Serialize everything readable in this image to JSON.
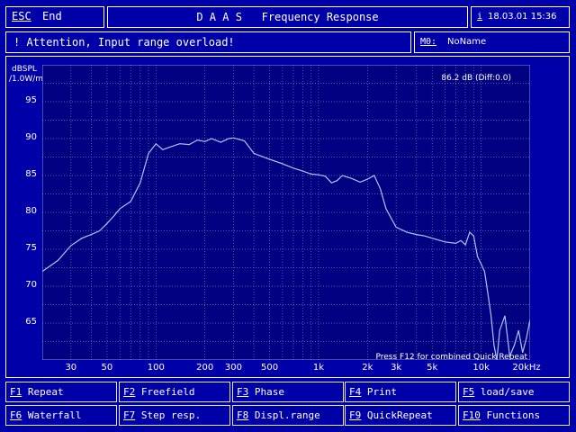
{
  "header": {
    "esc_key": "ESC",
    "esc_label": "End",
    "title": "D A A S   Frequency Response",
    "info_key": "i",
    "datetime": "18.03.01 15:36"
  },
  "status": {
    "message": "! Attention, Input range overload!",
    "memory_label": "M0:",
    "memory_value": "NoName"
  },
  "plot": {
    "ylabel_line1": "dBSPL",
    "ylabel_line2": "/1.0W/m",
    "readout": "86.2 dB (Diff:0.0)",
    "hint": "Press F12 for combined Quick Repeat"
  },
  "chart_data": {
    "type": "line",
    "xscale": "log",
    "xlim": [
      20,
      20000
    ],
    "ylim": [
      60,
      100
    ],
    "xlabel": "",
    "ylabel": "dBSPL /1.0W/m",
    "grid": true,
    "yticks": [
      65,
      70,
      75,
      80,
      85,
      90,
      95
    ],
    "xtick_labels": [
      "30",
      "50",
      "100",
      "200",
      "300",
      "500",
      "1k",
      "2k",
      "3k",
      "5k",
      "10k",
      "20kHz"
    ],
    "xticks": [
      30,
      50,
      100,
      200,
      300,
      500,
      1000,
      2000,
      3000,
      5000,
      10000,
      20000
    ],
    "series": [
      {
        "color": "#a8c8ff",
        "x": [
          20,
          25,
          30,
          35,
          40,
          45,
          50,
          55,
          60,
          70,
          80,
          90,
          100,
          110,
          120,
          140,
          160,
          180,
          200,
          220,
          250,
          280,
          300,
          350,
          400,
          500,
          600,
          700,
          800,
          900,
          1000,
          1100,
          1200,
          1300,
          1400,
          1600,
          1800,
          2000,
          2200,
          2400,
          2600,
          3000,
          3500,
          4000,
          4500,
          5000,
          6000,
          7000,
          7500,
          8000,
          8500,
          9000,
          9500,
          10000,
          10500,
          11000,
          11500,
          12000,
          12500,
          13000,
          14000,
          15000,
          16000,
          17000,
          18000,
          19000,
          20000
        ],
        "y": [
          72,
          73.5,
          75.5,
          76.5,
          77,
          77.5,
          78.5,
          79.5,
          80.5,
          81.5,
          84,
          88,
          89.3,
          88.5,
          88.8,
          89.3,
          89.2,
          89.8,
          89.6,
          90,
          89.5,
          90,
          90.1,
          89.7,
          88,
          87.2,
          86.6,
          86,
          85.6,
          85.2,
          85.1,
          84.9,
          84,
          84.3,
          85,
          84.6,
          84.1,
          84.5,
          85,
          83.2,
          80.5,
          78,
          77.3,
          77,
          76.8,
          76.5,
          76,
          75.8,
          76.2,
          75.6,
          77.3,
          76.8,
          74,
          73,
          72,
          69,
          66,
          62,
          60,
          64,
          66,
          60.5,
          62,
          64,
          61,
          63,
          65.5
        ]
      }
    ]
  },
  "fkeys": [
    {
      "key": "F1",
      "label": "Repeat"
    },
    {
      "key": "F2",
      "label": "Freefield"
    },
    {
      "key": "F3",
      "label": "Phase"
    },
    {
      "key": "F4",
      "label": "Print"
    },
    {
      "key": "F5",
      "label": "load/save"
    },
    {
      "key": "F6",
      "label": "Waterfall"
    },
    {
      "key": "F7",
      "label": "Step resp."
    },
    {
      "key": "F8",
      "label": "Displ.range"
    },
    {
      "key": "F9",
      "label": "QuickRepeat"
    },
    {
      "key": "F10",
      "label": "Functions"
    }
  ],
  "colors": {
    "background": "#0000a8",
    "plot_background": "#000080",
    "grid": "#6a7ad0",
    "trace": "#a8c8ff"
  }
}
